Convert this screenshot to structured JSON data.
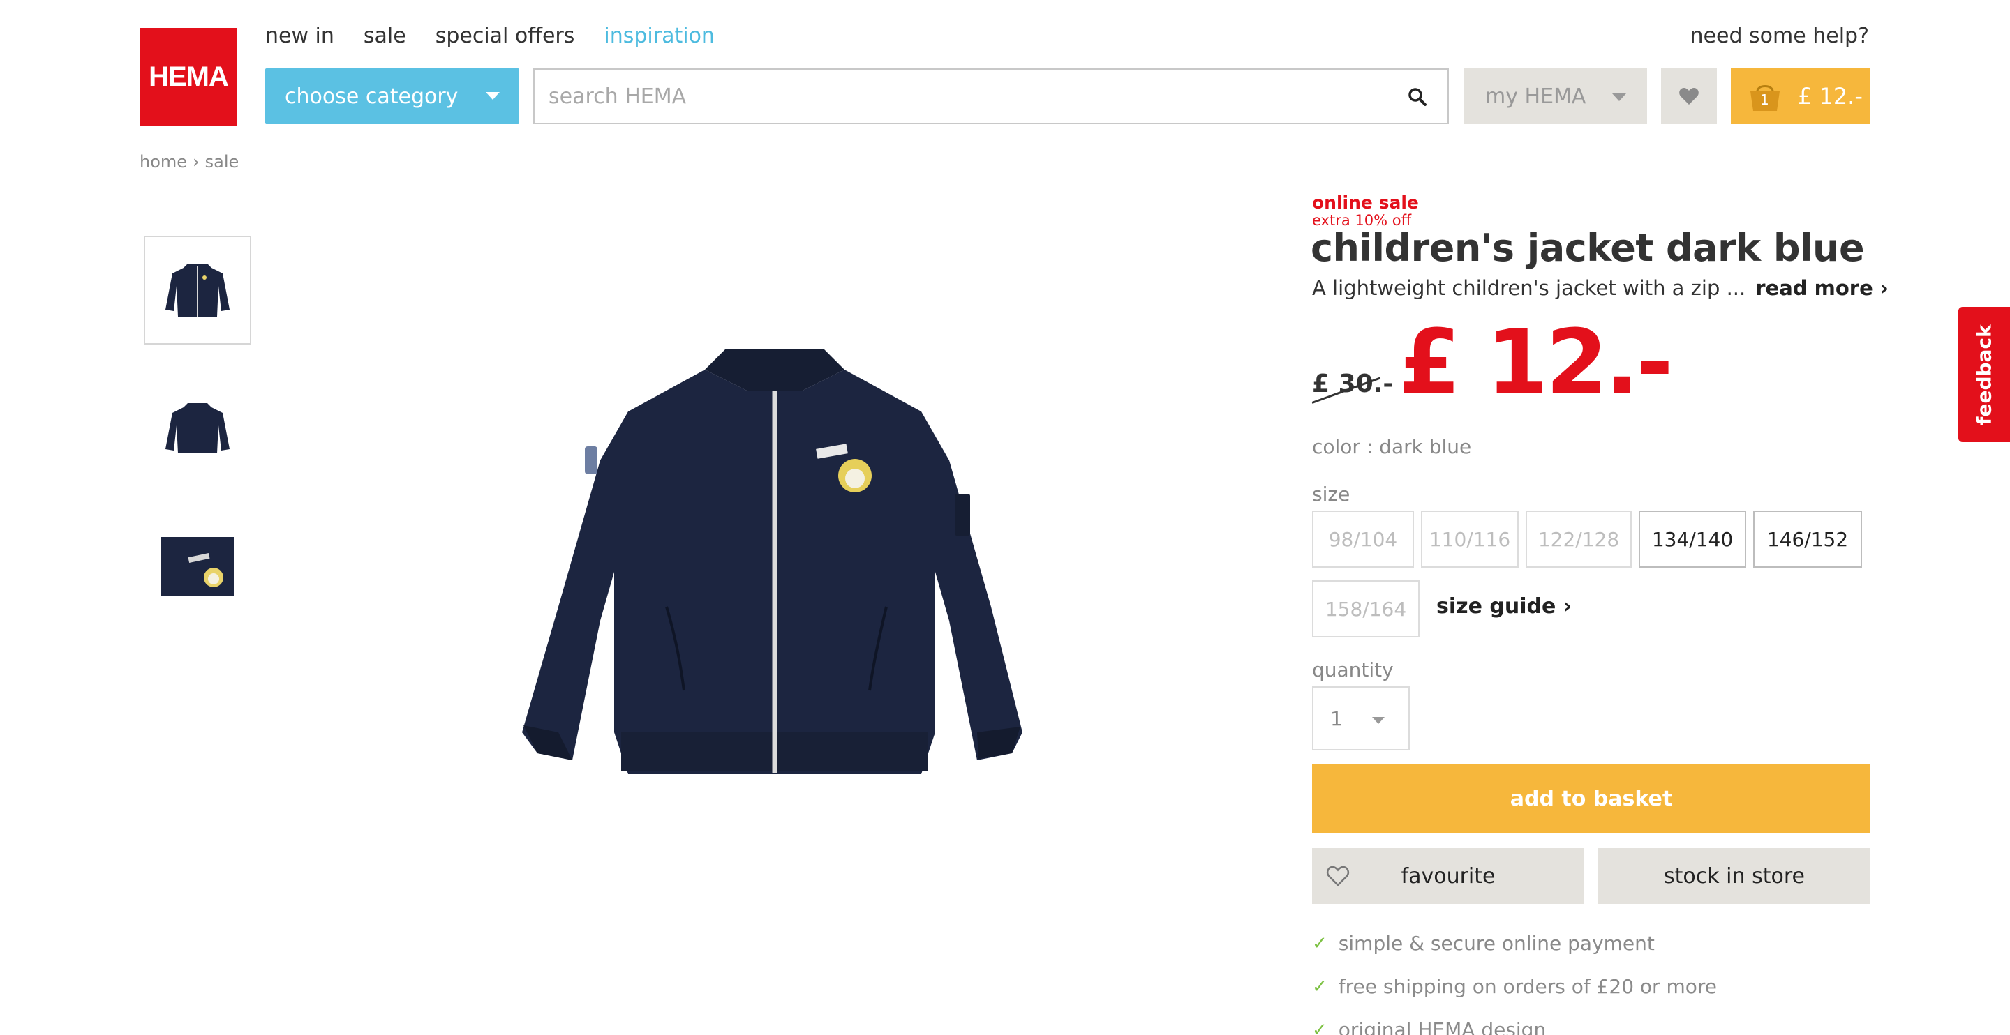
{
  "header": {
    "logo_text": "HEMA",
    "nav": [
      "new in",
      "sale",
      "special offers",
      "inspiration"
    ],
    "help": "need some help?",
    "category_button": "choose category",
    "search_placeholder": "search HEMA",
    "my_hema": "my HEMA",
    "basket_count": "1",
    "basket_total": "£ 12.-"
  },
  "breadcrumb": [
    "home",
    "sale"
  ],
  "product": {
    "badge": "online sale",
    "badge_sub": "extra 10% off",
    "title": "children's jacket dark blue",
    "description": "A lightweight children's jacket with a zip ...",
    "read_more": "read more",
    "old_price": "£ 30.-",
    "new_price": "£ 12.-",
    "color": "color : dark blue",
    "size_label": "size",
    "sizes": [
      {
        "label": "98/104",
        "available": false
      },
      {
        "label": "110/116",
        "available": false
      },
      {
        "label": "122/128",
        "available": false
      },
      {
        "label": "134/140",
        "available": true
      },
      {
        "label": "146/152",
        "available": true
      },
      {
        "label": "158/164",
        "available": false
      }
    ],
    "size_guide": "size guide",
    "quantity_label": "quantity",
    "quantity": "1",
    "add_to_basket": "add to basket",
    "favourite": "favourite",
    "stock_in_store": "stock in store",
    "usps": [
      "simple & secure online payment",
      "free shipping on orders of £20 or more",
      "original HEMA design"
    ]
  },
  "feedback": "feedback",
  "colors": {
    "brand_red": "#e3101b",
    "category_blue": "#5bc1e3",
    "basket_yellow": "#f6b73c",
    "button_grey": "#e4e2dd",
    "check_green": "#7cc142",
    "jacket_navy": "#1c2540"
  }
}
